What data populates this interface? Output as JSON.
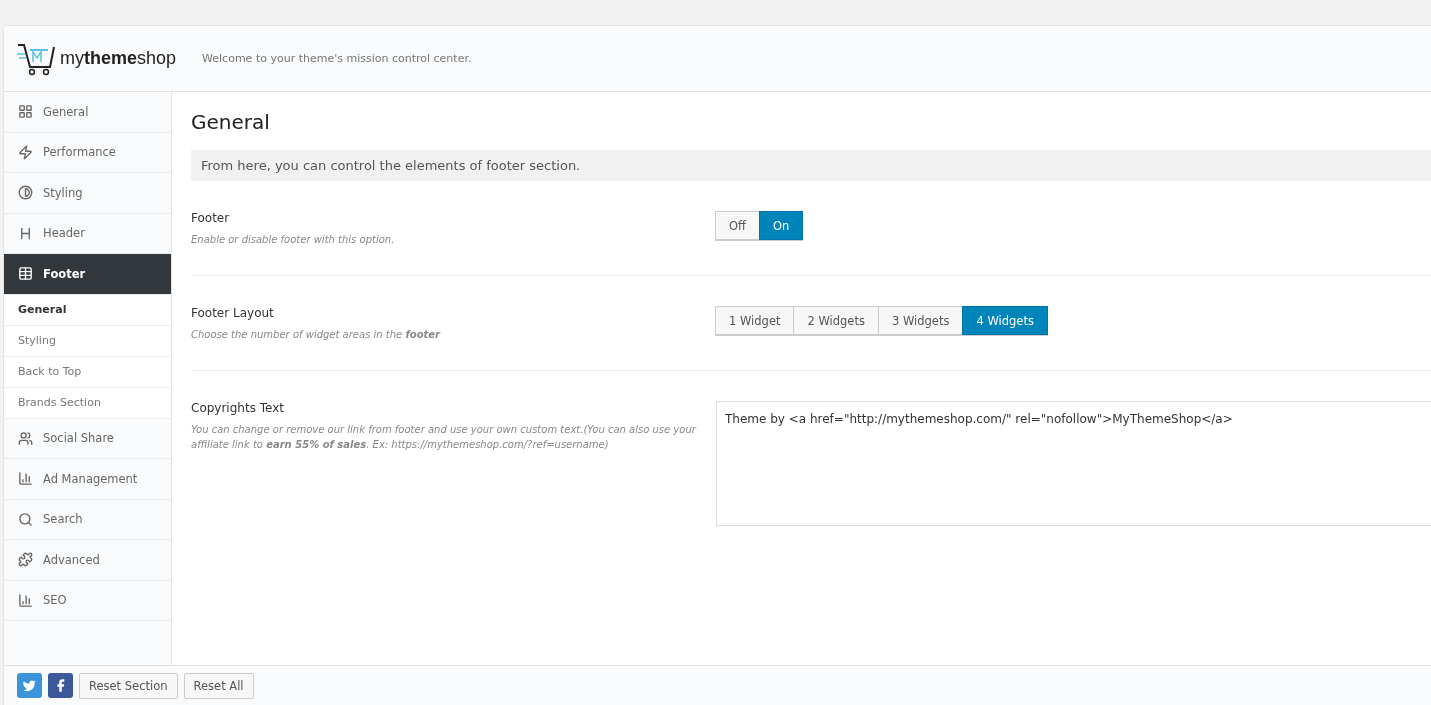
{
  "header": {
    "logo": "my**theme**shop",
    "tagline": "Welcome to your theme's mission control center."
  },
  "sidebar": {
    "items": [
      {
        "label": "General",
        "selected": false
      },
      {
        "label": "Performance",
        "selected": false
      },
      {
        "label": "Styling",
        "selected": false
      },
      {
        "label": "Header",
        "selected": false
      },
      {
        "label": "Footer",
        "selected": true,
        "children": [
          {
            "label": "General",
            "selected": true
          },
          {
            "label": "Styling",
            "selected": false
          },
          {
            "label": "Back to Top",
            "selected": false
          },
          {
            "label": "Brands Section",
            "selected": false
          }
        ]
      },
      {
        "label": "Social Share",
        "selected": false
      },
      {
        "label": "Ad Management",
        "selected": false
      },
      {
        "label": "Search",
        "selected": false
      },
      {
        "label": "Advanced",
        "selected": false
      },
      {
        "label": "SEO",
        "selected": false
      }
    ]
  },
  "content": {
    "title": "General",
    "intro": "From here, you can control the elements of footer section.",
    "options": [
      {
        "kind": "toggle",
        "label": "Footer",
        "description": "Enable or disable footer with this option.",
        "choices": [
          {
            "label": "Off",
            "selected": false
          },
          {
            "label": "On",
            "selected": true
          }
        ]
      },
      {
        "kind": "buttons",
        "label": "Footer Layout",
        "description": "Choose the number of widget areas in the **footer**",
        "choices": [
          {
            "label": "1 Widget",
            "selected": false
          },
          {
            "label": "2 Widgets",
            "selected": false
          },
          {
            "label": "3 Widgets",
            "selected": false
          },
          {
            "label": "4 Widgets",
            "selected": true
          }
        ]
      },
      {
        "kind": "textarea",
        "label": "Copyrights Text",
        "description": "You can change or remove our link from footer and use your own custom text.(You can also use your affiliate link to **earn 55% of sales**. Ex: https://mythemeshop.com/?ref=username)",
        "value": "Theme by <a href=\"http://mythemeshop.com/\" rel=\"nofollow\">MyThemeShop</a>"
      }
    ]
  },
  "footer": {
    "buttons": [
      "Reset Section",
      "Reset All"
    ]
  }
}
